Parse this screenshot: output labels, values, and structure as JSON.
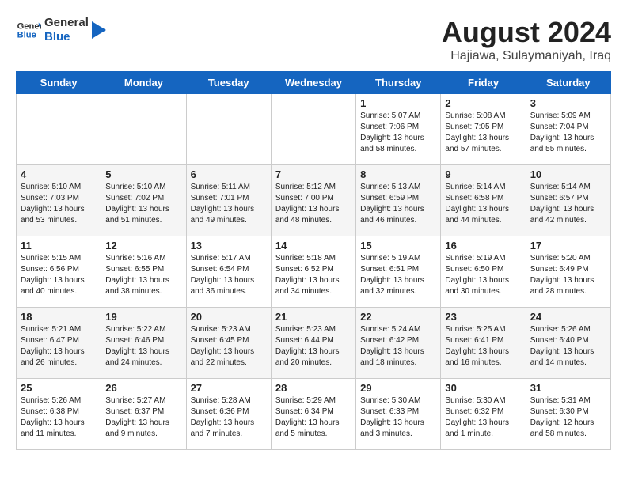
{
  "header": {
    "logo_line1": "General",
    "logo_line2": "Blue",
    "month_year": "August 2024",
    "location": "Hajiawa, Sulaymaniyah, Iraq"
  },
  "weekdays": [
    "Sunday",
    "Monday",
    "Tuesday",
    "Wednesday",
    "Thursday",
    "Friday",
    "Saturday"
  ],
  "weeks": [
    [
      {
        "day": "",
        "content": ""
      },
      {
        "day": "",
        "content": ""
      },
      {
        "day": "",
        "content": ""
      },
      {
        "day": "",
        "content": ""
      },
      {
        "day": "1",
        "content": "Sunrise: 5:07 AM\nSunset: 7:06 PM\nDaylight: 13 hours\nand 58 minutes."
      },
      {
        "day": "2",
        "content": "Sunrise: 5:08 AM\nSunset: 7:05 PM\nDaylight: 13 hours\nand 57 minutes."
      },
      {
        "day": "3",
        "content": "Sunrise: 5:09 AM\nSunset: 7:04 PM\nDaylight: 13 hours\nand 55 minutes."
      }
    ],
    [
      {
        "day": "4",
        "content": "Sunrise: 5:10 AM\nSunset: 7:03 PM\nDaylight: 13 hours\nand 53 minutes."
      },
      {
        "day": "5",
        "content": "Sunrise: 5:10 AM\nSunset: 7:02 PM\nDaylight: 13 hours\nand 51 minutes."
      },
      {
        "day": "6",
        "content": "Sunrise: 5:11 AM\nSunset: 7:01 PM\nDaylight: 13 hours\nand 49 minutes."
      },
      {
        "day": "7",
        "content": "Sunrise: 5:12 AM\nSunset: 7:00 PM\nDaylight: 13 hours\nand 48 minutes."
      },
      {
        "day": "8",
        "content": "Sunrise: 5:13 AM\nSunset: 6:59 PM\nDaylight: 13 hours\nand 46 minutes."
      },
      {
        "day": "9",
        "content": "Sunrise: 5:14 AM\nSunset: 6:58 PM\nDaylight: 13 hours\nand 44 minutes."
      },
      {
        "day": "10",
        "content": "Sunrise: 5:14 AM\nSunset: 6:57 PM\nDaylight: 13 hours\nand 42 minutes."
      }
    ],
    [
      {
        "day": "11",
        "content": "Sunrise: 5:15 AM\nSunset: 6:56 PM\nDaylight: 13 hours\nand 40 minutes."
      },
      {
        "day": "12",
        "content": "Sunrise: 5:16 AM\nSunset: 6:55 PM\nDaylight: 13 hours\nand 38 minutes."
      },
      {
        "day": "13",
        "content": "Sunrise: 5:17 AM\nSunset: 6:54 PM\nDaylight: 13 hours\nand 36 minutes."
      },
      {
        "day": "14",
        "content": "Sunrise: 5:18 AM\nSunset: 6:52 PM\nDaylight: 13 hours\nand 34 minutes."
      },
      {
        "day": "15",
        "content": "Sunrise: 5:19 AM\nSunset: 6:51 PM\nDaylight: 13 hours\nand 32 minutes."
      },
      {
        "day": "16",
        "content": "Sunrise: 5:19 AM\nSunset: 6:50 PM\nDaylight: 13 hours\nand 30 minutes."
      },
      {
        "day": "17",
        "content": "Sunrise: 5:20 AM\nSunset: 6:49 PM\nDaylight: 13 hours\nand 28 minutes."
      }
    ],
    [
      {
        "day": "18",
        "content": "Sunrise: 5:21 AM\nSunset: 6:47 PM\nDaylight: 13 hours\nand 26 minutes."
      },
      {
        "day": "19",
        "content": "Sunrise: 5:22 AM\nSunset: 6:46 PM\nDaylight: 13 hours\nand 24 minutes."
      },
      {
        "day": "20",
        "content": "Sunrise: 5:23 AM\nSunset: 6:45 PM\nDaylight: 13 hours\nand 22 minutes."
      },
      {
        "day": "21",
        "content": "Sunrise: 5:23 AM\nSunset: 6:44 PM\nDaylight: 13 hours\nand 20 minutes."
      },
      {
        "day": "22",
        "content": "Sunrise: 5:24 AM\nSunset: 6:42 PM\nDaylight: 13 hours\nand 18 minutes."
      },
      {
        "day": "23",
        "content": "Sunrise: 5:25 AM\nSunset: 6:41 PM\nDaylight: 13 hours\nand 16 minutes."
      },
      {
        "day": "24",
        "content": "Sunrise: 5:26 AM\nSunset: 6:40 PM\nDaylight: 13 hours\nand 14 minutes."
      }
    ],
    [
      {
        "day": "25",
        "content": "Sunrise: 5:26 AM\nSunset: 6:38 PM\nDaylight: 13 hours\nand 11 minutes."
      },
      {
        "day": "26",
        "content": "Sunrise: 5:27 AM\nSunset: 6:37 PM\nDaylight: 13 hours\nand 9 minutes."
      },
      {
        "day": "27",
        "content": "Sunrise: 5:28 AM\nSunset: 6:36 PM\nDaylight: 13 hours\nand 7 minutes."
      },
      {
        "day": "28",
        "content": "Sunrise: 5:29 AM\nSunset: 6:34 PM\nDaylight: 13 hours\nand 5 minutes."
      },
      {
        "day": "29",
        "content": "Sunrise: 5:30 AM\nSunset: 6:33 PM\nDaylight: 13 hours\nand 3 minutes."
      },
      {
        "day": "30",
        "content": "Sunrise: 5:30 AM\nSunset: 6:32 PM\nDaylight: 13 hours\nand 1 minute."
      },
      {
        "day": "31",
        "content": "Sunrise: 5:31 AM\nSunset: 6:30 PM\nDaylight: 12 hours\nand 58 minutes."
      }
    ]
  ]
}
